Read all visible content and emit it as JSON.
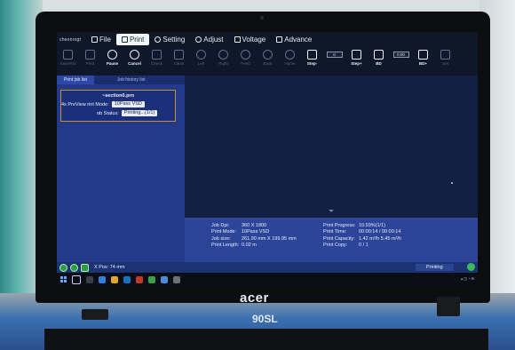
{
  "app": {
    "brand": "cheonrogt",
    "menu": [
      {
        "label": "File",
        "icon": "file-icon",
        "active": false
      },
      {
        "label": "Print",
        "icon": "print-icon",
        "active": true
      },
      {
        "label": "Setting",
        "icon": "gear-icon",
        "active": false
      },
      {
        "label": "Adjust",
        "icon": "adjust-icon",
        "active": false
      },
      {
        "label": "Voltage",
        "icon": "voltage-icon",
        "active": false
      },
      {
        "label": "Advance",
        "icon": "advance-icon",
        "active": false
      }
    ],
    "toolbar": [
      {
        "label": "SavePos",
        "icon": "save-position-icon",
        "enabled": false
      },
      {
        "label": "Print",
        "icon": "print-icon",
        "enabled": false
      },
      {
        "label": "Pause",
        "icon": "pause-icon",
        "enabled": true
      },
      {
        "label": "Cancel",
        "icon": "cancel-icon",
        "enabled": true
      },
      {
        "label": "Check",
        "icon": "check-icon",
        "enabled": false
      },
      {
        "label": "Clean",
        "icon": "clean-icon",
        "enabled": false
      },
      {
        "label": "Left",
        "icon": "arrow-left-icon",
        "enabled": false
      },
      {
        "label": "Right",
        "icon": "arrow-right-icon",
        "enabled": false
      },
      {
        "label": "Feed",
        "icon": "arrow-down-icon",
        "enabled": false
      },
      {
        "label": "Back",
        "icon": "arrow-up-icon",
        "enabled": false
      },
      {
        "label": "Home",
        "icon": "home-icon",
        "enabled": false
      },
      {
        "label": "Step-",
        "icon": "step-minus-icon",
        "enabled": true,
        "value": "0"
      },
      {
        "label": "Step+",
        "icon": "step-plus-icon",
        "enabled": true
      },
      {
        "label": "BD",
        "icon": "bd-icon",
        "enabled": true,
        "value": "0.00"
      },
      {
        "label": "BD+",
        "icon": "bd-plus-icon",
        "enabled": true
      },
      {
        "label": "Set",
        "icon": "set-icon",
        "enabled": false
      }
    ],
    "left_panel": {
      "tabs": [
        "Print job list",
        "Job history list"
      ],
      "job": {
        "name": "~section0.prn",
        "mode_label": "4s PreView rint Mode:",
        "mode_value": "10Pass VSD",
        "status_label": "ob Status:",
        "status_value": "Printing...(1/1)"
      }
    },
    "info": {
      "left": [
        {
          "k": "Job Dpi:",
          "v": "360 X 1800"
        },
        {
          "k": "Print Mode:",
          "v": "10Pass VSD"
        },
        {
          "k": "Job size:",
          "v": "261.90 mm X 199.95 mm"
        },
        {
          "k": "Print Length:",
          "v": "0.02 m"
        }
      ],
      "right": [
        {
          "k": "Print Progress:",
          "v": "10.59%(1/1)"
        },
        {
          "k": "Print Time:",
          "v": "00:00:14 / 00:00:14"
        },
        {
          "k": "Print Capacity:",
          "v": "1.42 m²/h    5.45 m²/h"
        },
        {
          "k": "Print Copy:",
          "v": "0 / 1"
        }
      ]
    },
    "statusbar": {
      "xpos": "X Pos: 74 mm",
      "state": "Printing"
    }
  },
  "hardware": {
    "brand": "acer",
    "model": "90SL"
  }
}
